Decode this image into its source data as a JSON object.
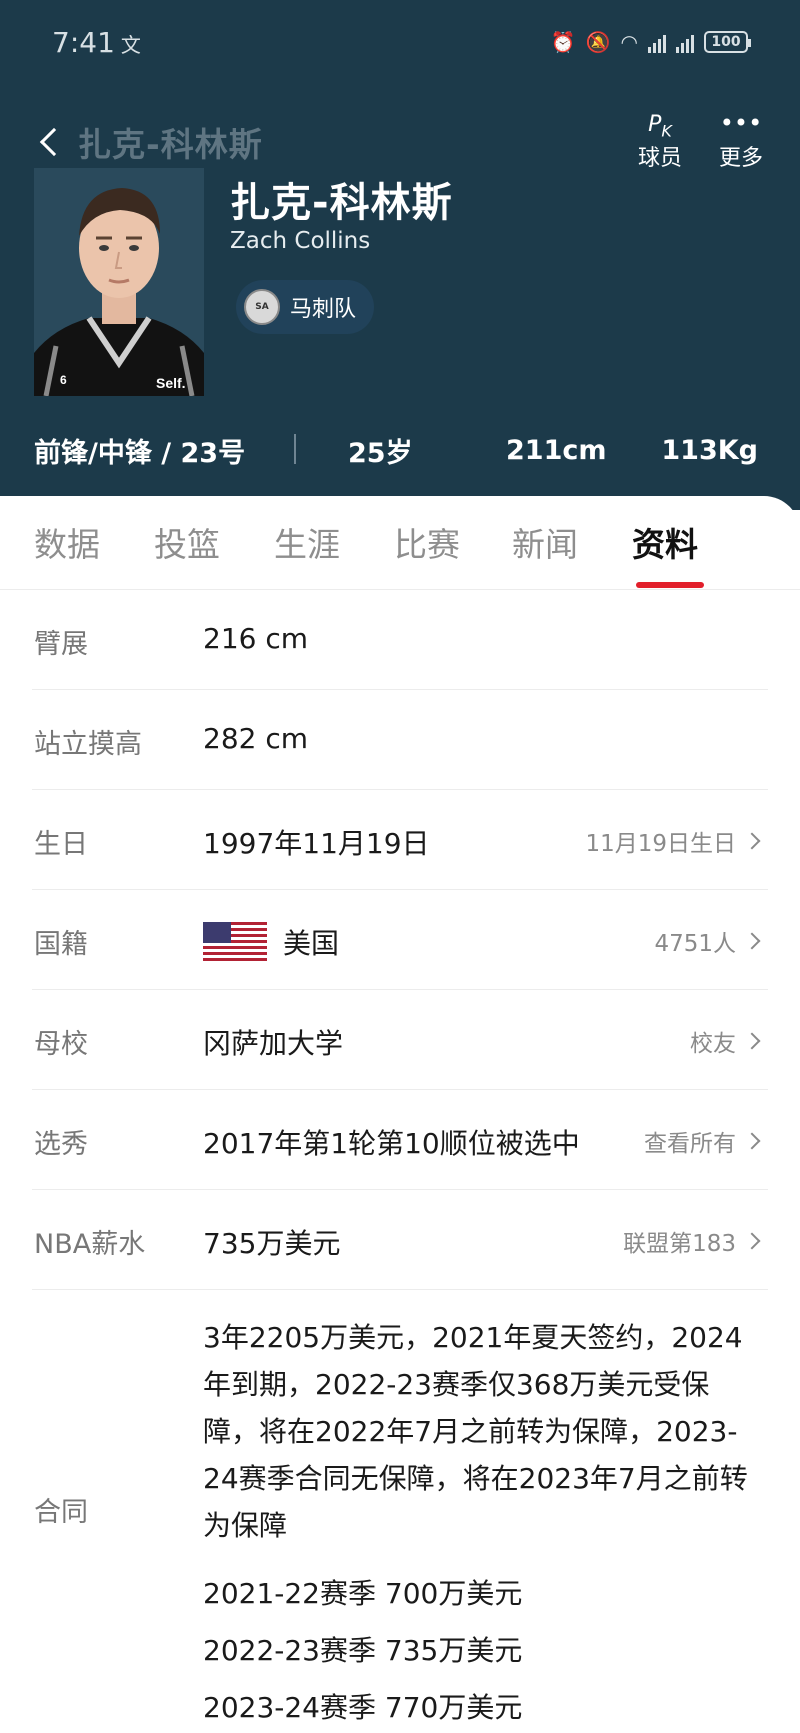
{
  "status_bar": {
    "time": "7:41",
    "time_suffix": "文",
    "battery": "100"
  },
  "nav": {
    "title": "扎克-科林斯",
    "actions": [
      {
        "icon": "pk-icon",
        "label": "球员"
      },
      {
        "icon": "more-icon",
        "label": "更多"
      }
    ]
  },
  "player": {
    "name_cn": "扎克-科林斯",
    "name_en": "Zach Collins",
    "team": "马刺队",
    "jersey_text": "Self.",
    "jersey_number": "6"
  },
  "summary": {
    "position": "前锋/中锋 / 23号",
    "age": "25岁",
    "height": "211cm",
    "weight": "113Kg"
  },
  "tabs": [
    {
      "label": "数据"
    },
    {
      "label": "投篮"
    },
    {
      "label": "生涯"
    },
    {
      "label": "比赛"
    },
    {
      "label": "新闻"
    },
    {
      "label": "资料",
      "active": true
    }
  ],
  "info": [
    {
      "key": "臂展",
      "value": "216 cm",
      "extra": ""
    },
    {
      "key": "站立摸高",
      "value": "282 cm",
      "extra": ""
    },
    {
      "key": "生日",
      "value": "1997年11月19日",
      "extra": "11月19日生日"
    },
    {
      "key": "国籍",
      "value": "美国",
      "extra": "4751人"
    },
    {
      "key": "母校",
      "value": "冈萨加大学",
      "extra": "校友"
    },
    {
      "key": "选秀",
      "value": "2017年第1轮第10顺位被选中",
      "extra": "查看所有"
    },
    {
      "key": "NBA薪水",
      "value": "735万美元",
      "extra": "联盟第183"
    }
  ],
  "contract": {
    "key": "合同",
    "text": "3年2205万美元，2021年夏天签约，2024年到期，2022-23赛季仅368万美元受保障，将在2022年7月之前转为保障，2023-24赛季合同无保障，将在2023年7月之前转为保障",
    "years": [
      "2021-22赛季 700万美元",
      "2022-23赛季 735万美元",
      "2023-24赛季 770万美元"
    ]
  },
  "colors": {
    "header_bg": "#1c3a4a",
    "tab_accent": "#e21f2b"
  }
}
